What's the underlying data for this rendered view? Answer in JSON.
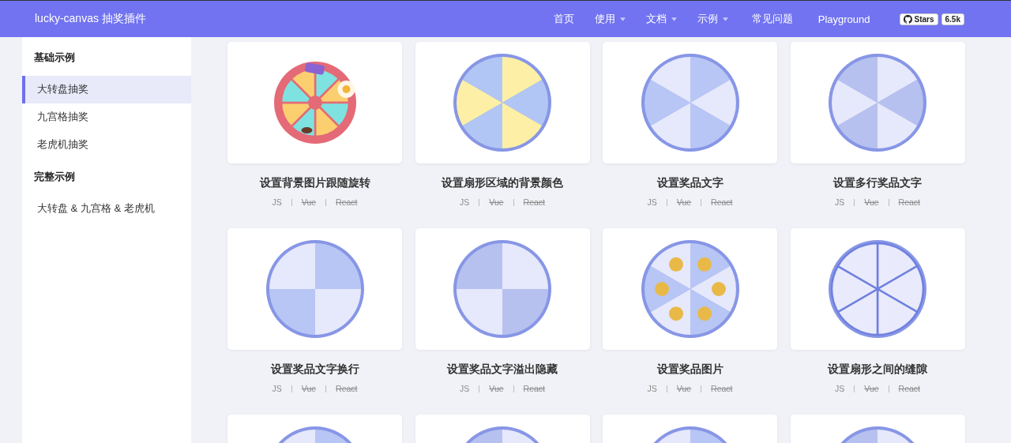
{
  "header": {
    "title": "lucky-canvas 抽奖插件",
    "nav": [
      {
        "label": "首页",
        "dropdown": false
      },
      {
        "label": "使用",
        "dropdown": true
      },
      {
        "label": "文档",
        "dropdown": true
      },
      {
        "label": "示例",
        "dropdown": true
      },
      {
        "label": "常见问题",
        "dropdown": false
      },
      {
        "label": "Playground",
        "dropdown": false
      }
    ],
    "stars_badge": {
      "label": "Stars",
      "count": "6.5k"
    }
  },
  "sidebar": {
    "groups": [
      {
        "heading": "基础示例",
        "items": [
          {
            "label": "大转盘抽奖",
            "selected": true
          },
          {
            "label": "九宫格抽奖",
            "selected": false
          },
          {
            "label": "老虎机抽奖",
            "selected": false
          }
        ]
      },
      {
        "heading": "完整示例",
        "items": [
          {
            "label": "大转盘 & 九宫格 & 老虎机",
            "selected": false
          }
        ]
      }
    ]
  },
  "cards": [
    {
      "preview": {
        "kind": "picture"
      },
      "title": "设置背景图片跟随旋转",
      "links": [
        {
          "label": "JS",
          "disabled": false
        },
        {
          "label": "Vue",
          "disabled": true
        },
        {
          "label": "React",
          "disabled": true
        }
      ]
    },
    {
      "preview": {
        "kind": "picture"
      },
      "title": "设置扇形区域的背景颜色",
      "links": [
        {
          "label": "JS",
          "disabled": false
        },
        {
          "label": "Vue",
          "disabled": true
        },
        {
          "label": "React",
          "disabled": true
        }
      ]
    },
    {
      "preview": {
        "kind": "picture"
      },
      "title": "设置奖品文字",
      "links": [
        {
          "label": "JS",
          "disabled": false
        },
        {
          "label": "Vue",
          "disabled": true
        },
        {
          "label": "React",
          "disabled": true
        }
      ]
    },
    {
      "preview": {
        "kind": "picture"
      },
      "title": "设置多行奖品文字",
      "links": [
        {
          "label": "JS",
          "disabled": false
        },
        {
          "label": "Vue",
          "disabled": true
        },
        {
          "label": "React",
          "disabled": true
        }
      ]
    },
    {
      "preview": {
        "kind": "picture"
      },
      "title": "设置奖品文字换行",
      "links": [
        {
          "label": "JS",
          "disabled": false
        },
        {
          "label": "Vue",
          "disabled": true
        },
        {
          "label": "React",
          "disabled": true
        }
      ]
    },
    {
      "preview": {
        "kind": "picture"
      },
      "title": "设置奖品文字溢出隐藏",
      "links": [
        {
          "label": "JS",
          "disabled": false
        },
        {
          "label": "Vue",
          "disabled": true
        },
        {
          "label": "React",
          "disabled": true
        }
      ]
    },
    {
      "preview": {
        "kind": "picture"
      },
      "title": "设置奖品图片",
      "links": [
        {
          "label": "JS",
          "disabled": false
        },
        {
          "label": "Vue",
          "disabled": true
        },
        {
          "label": "React",
          "disabled": true
        }
      ]
    },
    {
      "preview": {
        "kind": "picture"
      },
      "title": "设置扇形之间的缝隙",
      "links": [
        {
          "label": "JS",
          "disabled": false
        },
        {
          "label": "Vue",
          "disabled": true
        },
        {
          "label": "React",
          "disabled": true
        }
      ]
    },
    {
      "preview": {
        "kind": "picture"
      }
    },
    {
      "preview": {
        "kind": "picture"
      }
    },
    {
      "preview": {
        "kind": "picture"
      }
    },
    {
      "preview": {
        "kind": "picture"
      }
    }
  ]
}
